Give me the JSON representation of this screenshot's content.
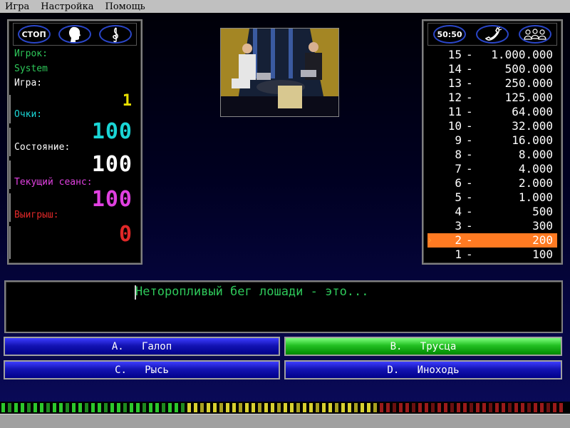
{
  "menu": [
    "Игра",
    "Настройка",
    "Помощь"
  ],
  "left_panel": {
    "lifelines": [
      {
        "label": "СТОП",
        "icon": "stop-icon"
      },
      {
        "label": "",
        "icon": "head-silhouette-icon"
      },
      {
        "label": "",
        "icon": "treble-clef-icon"
      }
    ],
    "player_label": "Игрок:",
    "player_name": "System",
    "game_label": "Игра:",
    "game_value": "1",
    "points_label": "Очки:",
    "points_value": "100",
    "state_label": "Состояние:",
    "state_value": "100",
    "session_label": "Текущий сеанс:",
    "session_value": "100",
    "winnings_label": "Выигрыш:",
    "winnings_value": "0"
  },
  "right_panel": {
    "lifelines": [
      {
        "label": "50:50",
        "icon": "fifty-fifty-icon"
      },
      {
        "label": "",
        "icon": "phone-a-friend-icon"
      },
      {
        "label": "",
        "icon": "ask-audience-icon"
      }
    ],
    "ladder": [
      {
        "num": "15",
        "amount": "1.000.000"
      },
      {
        "num": "14",
        "amount": "500.000"
      },
      {
        "num": "13",
        "amount": "250.000"
      },
      {
        "num": "12",
        "amount": "125.000"
      },
      {
        "num": "11",
        "amount": "64.000"
      },
      {
        "num": "10",
        "amount": "32.000"
      },
      {
        "num": "9",
        "amount": "16.000"
      },
      {
        "num": "8",
        "amount": "8.000"
      },
      {
        "num": "7",
        "amount": "4.000"
      },
      {
        "num": "6",
        "amount": "2.000"
      },
      {
        "num": "5",
        "amount": "1.000"
      },
      {
        "num": "4",
        "amount": "500"
      },
      {
        "num": "3",
        "amount": "300"
      },
      {
        "num": "2",
        "amount": "200"
      },
      {
        "num": "1",
        "amount": "100"
      }
    ],
    "current_level": "2",
    "current_marker": "›"
  },
  "question": "Неторопливый бег лошади - это...",
  "answers": [
    {
      "letter": "A.",
      "text": "Галоп"
    },
    {
      "letter": "B.",
      "text": "Трусца"
    },
    {
      "letter": "C.",
      "text": "Рысь"
    },
    {
      "letter": "D.",
      "text": "Иноходь"
    }
  ],
  "selected_answer": "B",
  "colors": {
    "player": "#2ec85a",
    "points": "#1ad6d6",
    "state": "#ffffff",
    "session": "#e040e0",
    "winnings": "#e02828",
    "game": "#e8e000",
    "ladder_highlight": "#ff7a22",
    "answer_blue": "#1414b4",
    "answer_green": "#22c022"
  },
  "timer": {
    "total_cells": 88,
    "green_cells": 29,
    "yellow_cells": 30,
    "red_cells": 29
  }
}
